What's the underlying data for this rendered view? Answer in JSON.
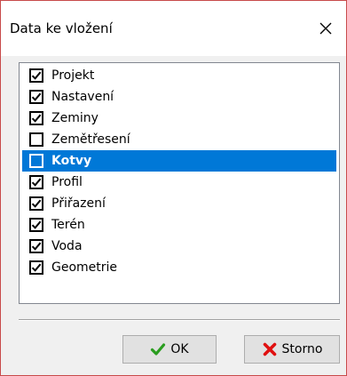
{
  "window": {
    "title": "Data ke vložení"
  },
  "list": {
    "items": [
      {
        "label": "Projekt",
        "checked": true,
        "selected": false
      },
      {
        "label": "Nastavení",
        "checked": true,
        "selected": false
      },
      {
        "label": "Zeminy",
        "checked": true,
        "selected": false
      },
      {
        "label": "Zemětřesení",
        "checked": false,
        "selected": false
      },
      {
        "label": "Kotvy",
        "checked": false,
        "selected": true
      },
      {
        "label": "Profil",
        "checked": true,
        "selected": false
      },
      {
        "label": "Přiřazení",
        "checked": true,
        "selected": false
      },
      {
        "label": "Terén",
        "checked": true,
        "selected": false
      },
      {
        "label": "Voda",
        "checked": true,
        "selected": false
      },
      {
        "label": "Geometrie",
        "checked": true,
        "selected": false
      }
    ]
  },
  "buttons": {
    "ok_label": "OK",
    "cancel_label": "Storno"
  },
  "icons": {
    "close": "close-icon",
    "ok": "checkmark-icon",
    "cancel": "x-cross-icon"
  },
  "colors": {
    "selection": "#0078d7",
    "window_border": "#c84a4a",
    "ok_icon": "#2a9d1f",
    "cancel_icon": "#e01010"
  }
}
